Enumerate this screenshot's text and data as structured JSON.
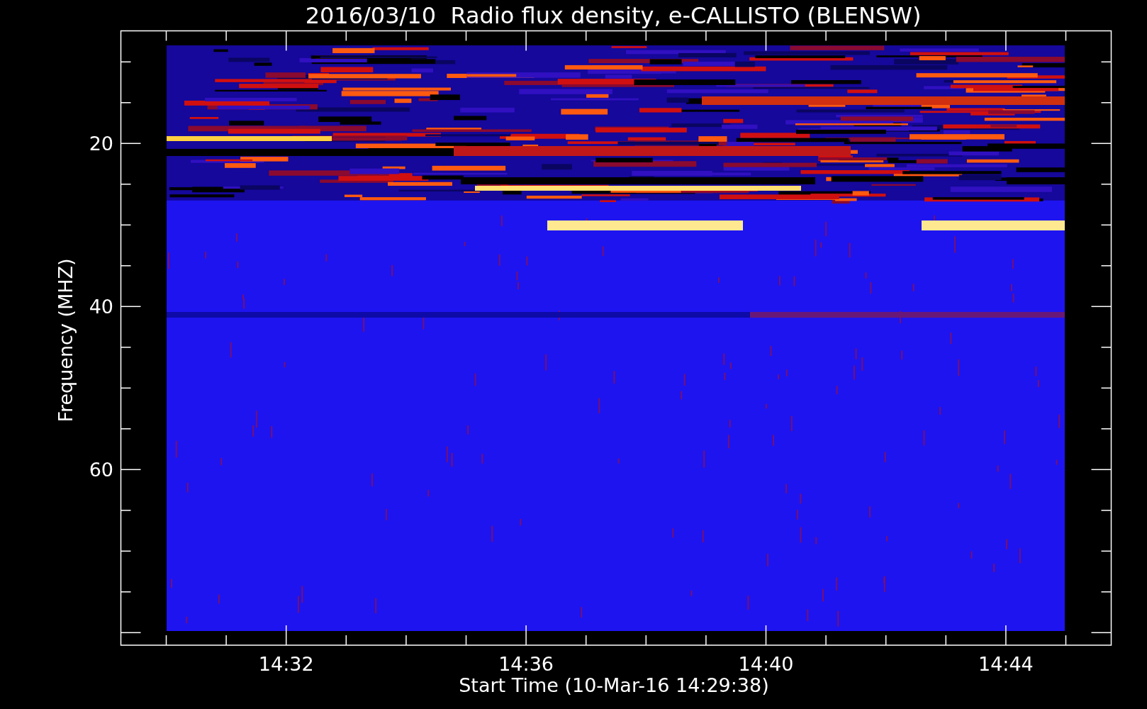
{
  "title": "2016/03/10  Radio flux density, e-CALLISTO (BLENSW)",
  "ylabel": "Frequency (MHZ)",
  "xlabel": "Start Time (10-Mar-16 14:29:38)",
  "yticks": [
    "20",
    "40",
    "60"
  ],
  "xticks": [
    "14:32",
    "14:36",
    "14:40",
    "14:44"
  ]
}
